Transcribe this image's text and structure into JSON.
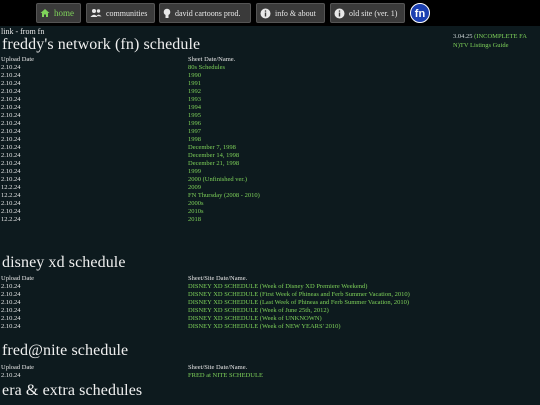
{
  "nav": {
    "home": "home",
    "communities": "communities",
    "david": "david cartoons prod.",
    "info": "info & about",
    "old_site": "old site (ver. 1)",
    "logo_text": "fn"
  },
  "breadcrumb": "link - from fn",
  "notice": {
    "date": "3.04.25",
    "link_line1": "(INCOMPLETE FA",
    "link_line2": "N)TV Listings Guide"
  },
  "sections": [
    {
      "title": "freddy's network (fn) schedule",
      "col1": "Upload Date",
      "col2": "Sheet Date/Name.",
      "rows": [
        [
          "2.10.24",
          "80s Schedules"
        ],
        [
          "2.10.24",
          "1990"
        ],
        [
          "2.10.24",
          "1991"
        ],
        [
          "2.10.24",
          "1992"
        ],
        [
          "2.10.24",
          "1993"
        ],
        [
          "2.10.24",
          "1994"
        ],
        [
          "2.10.24",
          "1995"
        ],
        [
          "2.10.24",
          "1996"
        ],
        [
          "2.10.24",
          "1997"
        ],
        [
          "2.10.24",
          "1998"
        ],
        [
          "2.10.24",
          "December 7, 1998"
        ],
        [
          "2.10.24",
          "December 14, 1998"
        ],
        [
          "2.10.24",
          "December 21, 1998"
        ],
        [
          "2.10.24",
          "1999"
        ],
        [
          "2.10.24",
          "2000 (Unfinished ver.)"
        ],
        [
          "12.2.24",
          "2009"
        ],
        [
          "12.2.24",
          "FN Thursday (2008 - 2010)"
        ],
        [
          "2.10.24",
          "2000s"
        ],
        [
          "2.10.24",
          "2010s"
        ],
        [
          "12.2.24",
          "2018"
        ]
      ]
    },
    {
      "title": "disney xd schedule",
      "col1": "Upload Date",
      "col2": "Sheet/Site Date/Name.",
      "rows": [
        [
          "2.10.24",
          "DISNEY XD SCHEDULE (Week of Disney XD Premiere Weekend)"
        ],
        [
          "2.10.24",
          "DISNEY XD SCHEDULE (First Week of Phineas and Ferb Summer Vacation, 2010)"
        ],
        [
          "2.10.24",
          "DISNEY XD SCHEDULE (Last Week of Phineas and Ferb Summer Vacation, 2010)"
        ],
        [
          "2.10.24",
          "DISNEY XD SCHEDULE (Week of June 25th, 2012)"
        ],
        [
          "2.10.24",
          "DISNEY XD SCHEDULE (Week of UNKNOWN)"
        ],
        [
          "2.10.24",
          "DISNEY XD SCHEDULE (Week of NEW YEARS' 2010)"
        ]
      ]
    },
    {
      "title": "fred@nite schedule",
      "col1": "Upload Date",
      "col2": "Sheet/Site Date/Name.",
      "rows": [
        [
          "2.10.24",
          "FRED at NITE SCHEDULE"
        ]
      ]
    },
    {
      "title": "era & extra schedules",
      "col1": "",
      "col2": "",
      "rows": []
    }
  ],
  "colors": {
    "background": "#0d1a1e",
    "link": "#7fd35a",
    "text": "#e8e8e8",
    "bar": "#000000",
    "tab": "#3a3a3a"
  },
  "icons": [
    "home-icon",
    "people-icon",
    "lightbulb-icon",
    "info-icon",
    "info-icon",
    "fn-logo"
  ]
}
